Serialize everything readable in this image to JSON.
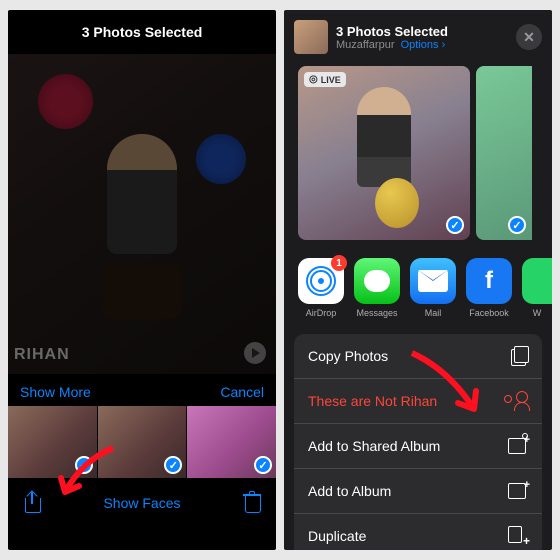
{
  "left": {
    "title": "3 Photos Selected",
    "watermark": "RIHAN",
    "show_more": "Show More",
    "cancel": "Cancel",
    "show_faces": "Show Faces"
  },
  "right": {
    "title": "3 Photos Selected",
    "subtitle": "Muzaffarpur",
    "options": "Options",
    "live_badge": "LIVE",
    "close": "✕",
    "airdrop_badge": "1",
    "apps": [
      {
        "label": "AirDrop"
      },
      {
        "label": "Messages"
      },
      {
        "label": "Mail"
      },
      {
        "label": "Facebook"
      },
      {
        "label": "W"
      }
    ],
    "actions": {
      "copy": "Copy Photos",
      "not_person": "These are Not Rihan",
      "shared_album": "Add to Shared Album",
      "add_album": "Add to Album",
      "duplicate": "Duplicate"
    }
  }
}
